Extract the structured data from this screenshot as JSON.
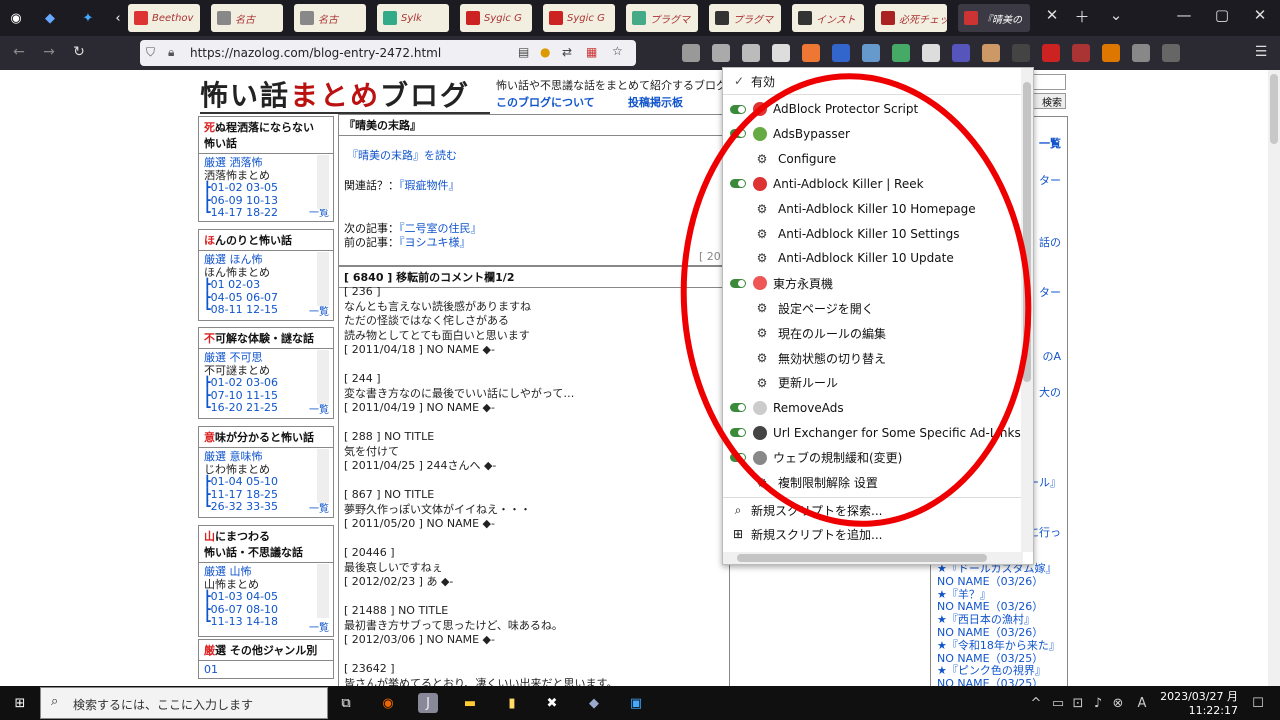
{
  "browser": {
    "tabs": [
      {
        "label": "Beethov",
        "color": "#d33"
      },
      {
        "label": "名古",
        "color": "#888"
      },
      {
        "label": "名古",
        "color": "#888"
      },
      {
        "label": "Sylk",
        "color": "#3a8"
      },
      {
        "label": "Sygic G",
        "color": "#c22"
      },
      {
        "label": "Sygic G",
        "color": "#c22"
      },
      {
        "label": "プラグマ",
        "color": "#4a8"
      },
      {
        "label": "プラグマ",
        "color": "#333"
      },
      {
        "label": "インスト",
        "color": "#333"
      },
      {
        "label": "必死チェッカー",
        "color": "#a22"
      },
      {
        "label": "『晴美の",
        "color": "#c33"
      }
    ],
    "url": "https://nazolog.com/blog-entry-2472.html"
  },
  "blog": {
    "logo_main": "怖い話",
    "logo_accent": "まとめ",
    "logo_end": "ブログ",
    "tagline": "怖い話や不思議な話をまとめて紹介するブログ",
    "link_about": "このブログについて",
    "link_board": "投稿掲示板",
    "search_btn": "検索",
    "sidebar": [
      {
        "first": "死",
        "title": "ぬ程洒落にならない",
        "title2": "怖い話",
        "link": "厳選 洒落怖",
        "sub": "洒落怖まとめ",
        "items": [
          "┣01-02 03-05",
          "┣06-09 10-13",
          "┗14-17 18-22"
        ],
        "more": "一覧"
      },
      {
        "first": "ほ",
        "title": "んのりと怖い話",
        "title2": "",
        "link": "厳選 ほん怖",
        "sub": "ほん怖まとめ",
        "items": [
          "┣01 02-03",
          "┣04-05 06-07",
          "┗08-11 12-15"
        ],
        "more": "一覧"
      },
      {
        "first": "不",
        "title": "可解な体験・謎な話",
        "title2": "",
        "link": "厳選 不可思",
        "sub": "不可謎まとめ",
        "items": [
          "┣01-02 03-06",
          "┣07-10 11-15",
          "┗16-20 21-25"
        ],
        "more": "一覧"
      },
      {
        "first": "意",
        "title": "味が分かると怖い話",
        "title2": "",
        "link": "厳選 意味怖",
        "sub": "じわ怖まとめ",
        "items": [
          "┣01-04 05-10",
          "┣11-17 18-25",
          "┗26-32 33-35"
        ],
        "more": "一覧"
      },
      {
        "first": "山",
        "title": "にまつわる",
        "title2": "怖い話・不思議な話",
        "link": "厳選 山怖",
        "sub": "山怖まとめ",
        "items": [
          "┣01-03 04-05",
          "┣06-07 08-10",
          "┗11-13 14-18"
        ],
        "more": "一覧"
      }
    ],
    "sidebar_other": {
      "first": "厳",
      "title": "選 その他ジャンル別",
      "item": "01"
    },
    "article": {
      "title": "『晴美の末路』",
      "read_link": "『晴美の末路』を読む",
      "related_label": "関連話？：",
      "related_link": "『瑕疵物件』",
      "next_label": "次の記事：",
      "next_link": "『二号室の住民』",
      "prev_label": "前の記事：",
      "prev_link": "『ヨシユキ様』",
      "date_stub": "[ 201"
    },
    "comments_header": "[ 6840 ] 移転前のコメント欄1/2",
    "comments": [
      "[ 236 ]\nなんとも言えない読後感がありますね\nただの怪談ではなく侘しさがある\n読み物としてとても面白いと思います\n[ 2011/04/18 ] NO NAME ◆-",
      "[ 244 ]\n変な書き方なのに最後でいい話にしやがって…\n[ 2011/04/19 ] NO NAME ◆-",
      "[ 288 ] NO TITLE\n気を付けて\n[ 2011/04/25 ] 244さんへ ◆-",
      "[ 867 ] NO TITLE\n夢野久作っぽい文体がイイねえ・・・\n[ 2011/05/20 ] NO NAME ◆-",
      "[ 20446 ]\n最後哀しいですねぇ\n[ 2012/02/23 ] あ ◆-",
      "[ 21488 ] NO TITLE\n最初書き方サブって思ったけど、味あるね。\n[ 2012/03/06 ] NO NAME ◆-",
      "[ 23642 ]\n皆さんが挙めてるとおり、凄くいい出来だと思います。"
    ],
    "right_header": "一覧",
    "right_snippets": [
      "ター",
      "話の",
      "ター",
      "のA",
      "大の",
      "ール』",
      "に行っ"
    ],
    "recent": [
      "★『ドールカスタム嫁』",
      "NO NAME（03/26）",
      "★『羊？』",
      "NO NAME（03/26）",
      "★『西日本の漁村』",
      "NO NAME（03/26）",
      "★『令和18年から来た』",
      "NO NAME（03/25）",
      "★『ピンク色の視界』",
      "NO NAME（03/25）"
    ]
  },
  "menu": {
    "header": "有効",
    "items": [
      {
        "label": "AdBlock Protector Script",
        "toggle": true,
        "icon": "#d33",
        "arrow": true,
        "sub": false
      },
      {
        "label": "AdsBypasser",
        "toggle": true,
        "icon": "#6a4",
        "arrow": true,
        "sub": false
      },
      {
        "label": "Configure",
        "toggle": false,
        "icon": "gear",
        "arrow": false,
        "sub": true
      },
      {
        "label": "Anti-Adblock Killer | Reek",
        "toggle": true,
        "icon": "#d33",
        "arrow": true,
        "sub": false
      },
      {
        "label": "Anti-Adblock Killer 10 Homepage",
        "toggle": false,
        "icon": "gear",
        "arrow": false,
        "sub": true
      },
      {
        "label": "Anti-Adblock Killer 10 Settings",
        "toggle": false,
        "icon": "gear",
        "arrow": false,
        "sub": true
      },
      {
        "label": "Anti-Adblock Killer 10 Update",
        "toggle": false,
        "icon": "gear",
        "arrow": false,
        "sub": true
      },
      {
        "label": "東方永頁機",
        "toggle": true,
        "icon": "#e55",
        "arrow": true,
        "sub": false
      },
      {
        "label": "設定ページを開く",
        "toggle": false,
        "icon": "gear",
        "arrow": false,
        "sub": true
      },
      {
        "label": "現在のルールの編集",
        "toggle": false,
        "icon": "gear",
        "arrow": false,
        "sub": true
      },
      {
        "label": "無効状態の切り替え",
        "toggle": false,
        "icon": "gear",
        "arrow": false,
        "sub": true
      },
      {
        "label": "更新ルール",
        "toggle": false,
        "icon": "gear",
        "arrow": false,
        "sub": true
      },
      {
        "label": "RemoveAds",
        "toggle": true,
        "icon": "#ccc",
        "arrow": true,
        "sub": false
      },
      {
        "label": "Url Exchanger for Some Specific Ad-Links",
        "toggle": true,
        "icon": "#444",
        "arrow": true,
        "sub": false
      },
      {
        "label": "ウェブの規制緩和(変更)",
        "toggle": true,
        "icon": "#888",
        "arrow": true,
        "sub": false
      },
      {
        "label": "複制限制解除 设置",
        "toggle": false,
        "icon": "gear",
        "arrow": false,
        "sub": true
      }
    ],
    "find_script": "新規スクリプトを探索...",
    "new_script": "新規スクリプトを追加..."
  },
  "taskbar": {
    "search_placeholder": "検索するには、ここに入力します",
    "date": "2023/03/27 月",
    "time": "11:22:17"
  }
}
